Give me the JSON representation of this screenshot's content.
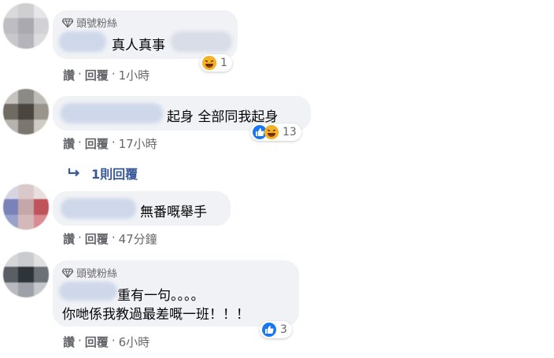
{
  "comments": [
    {
      "fan_badge": "頭號粉絲",
      "text_line1": "真人真事",
      "reaction_count": "1",
      "actions": {
        "like": "讚",
        "reply": "回覆",
        "time": "1小時"
      }
    },
    {
      "text_line1": "起身 全部同我起身",
      "reaction_count": "13",
      "actions": {
        "like": "讚",
        "reply": "回覆",
        "time": "17小時"
      },
      "replies_link": "1則回覆"
    },
    {
      "text_line1": "無番嘅舉手",
      "actions": {
        "like": "讚",
        "reply": "回覆",
        "time": "47分鐘"
      }
    },
    {
      "fan_badge": "頭號粉絲",
      "text_line1": "重有一句。。。。",
      "text_line2": "你哋係我教過最差嘅一班！！！",
      "reaction_count": "3",
      "actions": {
        "like": "讚",
        "reply": "回覆",
        "time": "6小時"
      }
    }
  ],
  "colors": {
    "bubble": "#f0f2f5",
    "meta": "#65676b",
    "link": "#385898",
    "like_blue": "#1877f2",
    "haha_yellow": "#f7b125"
  },
  "icons": [
    "diamond-icon",
    "like-reaction-icon",
    "haha-reaction-icon",
    "reply-arrow-icon"
  ]
}
